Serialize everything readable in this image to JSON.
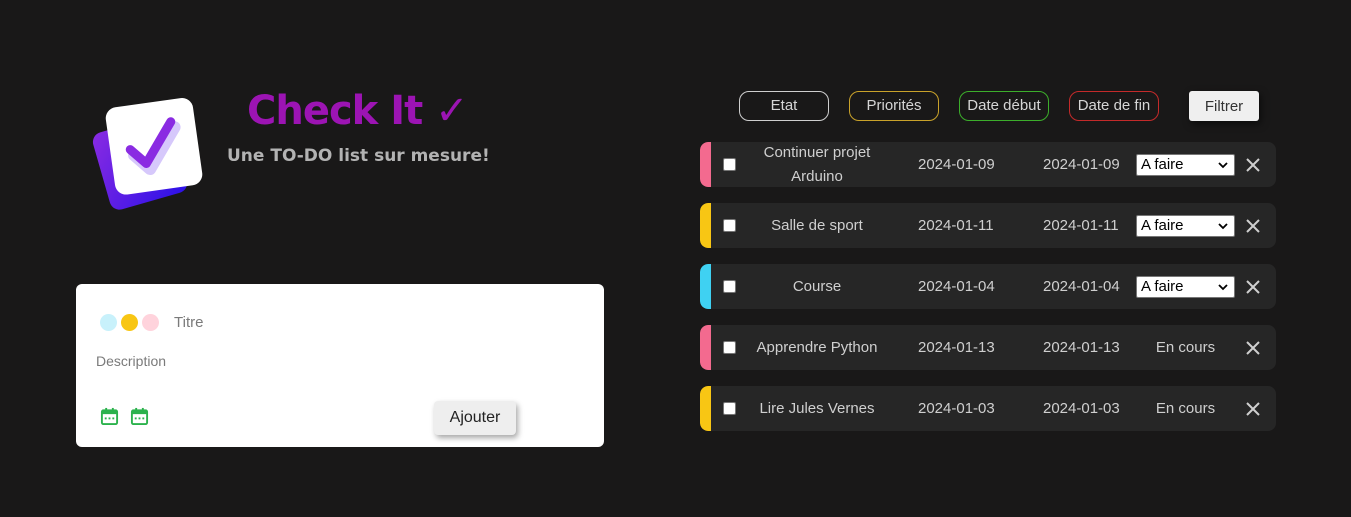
{
  "header": {
    "title": "Check It ✓",
    "subtitle": "Une TO-DO list sur mesure!"
  },
  "form": {
    "title_placeholder": "Titre",
    "description_placeholder": "Description",
    "priority_colors": [
      "#c8f1fb",
      "#f8c614",
      "#ffd3dc"
    ],
    "add_label": "Ajouter"
  },
  "filters": {
    "etat": "Etat",
    "priorites": "Priorités",
    "date_debut": "Date début",
    "date_fin": "Date de fin",
    "filter_button": "Filtrer"
  },
  "tasks": [
    {
      "title": "Continuer projet Arduino",
      "start": "2024-01-09",
      "end": "2024-01-09",
      "status": "A faire",
      "editable": true,
      "color": "#f36a8f"
    },
    {
      "title": "Salle de sport",
      "start": "2024-01-11",
      "end": "2024-01-11",
      "status": "A faire",
      "editable": true,
      "color": "#f8c614"
    },
    {
      "title": "Course",
      "start": "2024-01-04",
      "end": "2024-01-04",
      "status": "A faire",
      "editable": true,
      "color": "#3fd1f2"
    },
    {
      "title": "Apprendre Python",
      "start": "2024-01-13",
      "end": "2024-01-13",
      "status": "En cours",
      "editable": false,
      "color": "#f36a8f"
    },
    {
      "title": "Lire Jules Vernes",
      "start": "2024-01-03",
      "end": "2024-01-03",
      "status": "En cours",
      "editable": false,
      "color": "#f8c614"
    }
  ],
  "colors": {
    "accent": "#9c14b3",
    "background": "#191818",
    "task_bg": "#262626"
  },
  "icons": {
    "logo": "checklist-logo-icon",
    "calendar": "calendar-icon",
    "delete": "close-icon",
    "dropdown": "chevron-down-icon"
  }
}
